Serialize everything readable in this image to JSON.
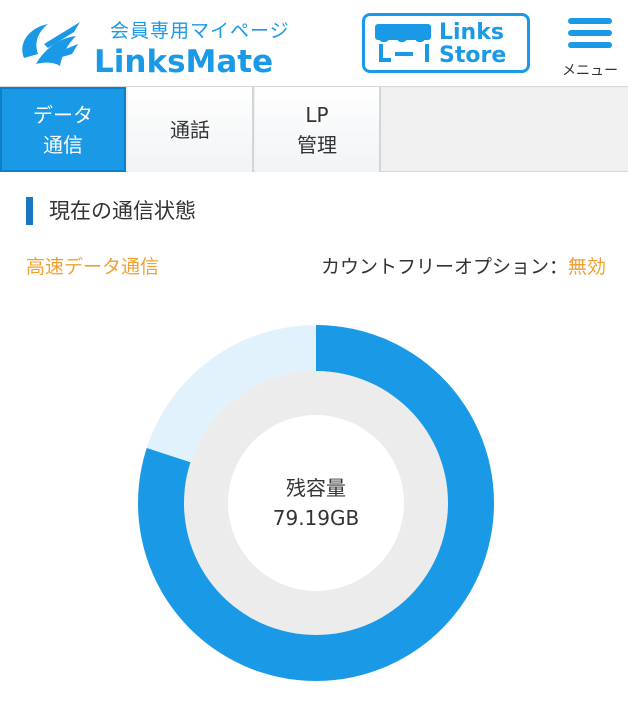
{
  "header": {
    "subtitle": "会員専用マイページ",
    "brand": "LinksMate",
    "store_line1": "Links",
    "store_line2": "Store",
    "menu_label": "メニュー"
  },
  "tabs": [
    {
      "line1": "データ",
      "line2": "通信",
      "active": true
    },
    {
      "line1": "通話",
      "line2": "",
      "active": false
    },
    {
      "line1": "LP",
      "line2": "管理",
      "active": false
    }
  ],
  "section": {
    "title": "現在の通信状態",
    "speed_mode": "高速データ通信",
    "countfree_label": "カウントフリーオプション：",
    "countfree_status": "無効"
  },
  "usage": {
    "remaining_label": "残容量",
    "remaining_value": "79.19GB",
    "remaining_fraction": 0.8
  },
  "colors": {
    "accent": "#1a9ae6",
    "donut_track": "#e2f2fc",
    "donut_inner": "#ececec",
    "highlight": "#f0a030"
  }
}
